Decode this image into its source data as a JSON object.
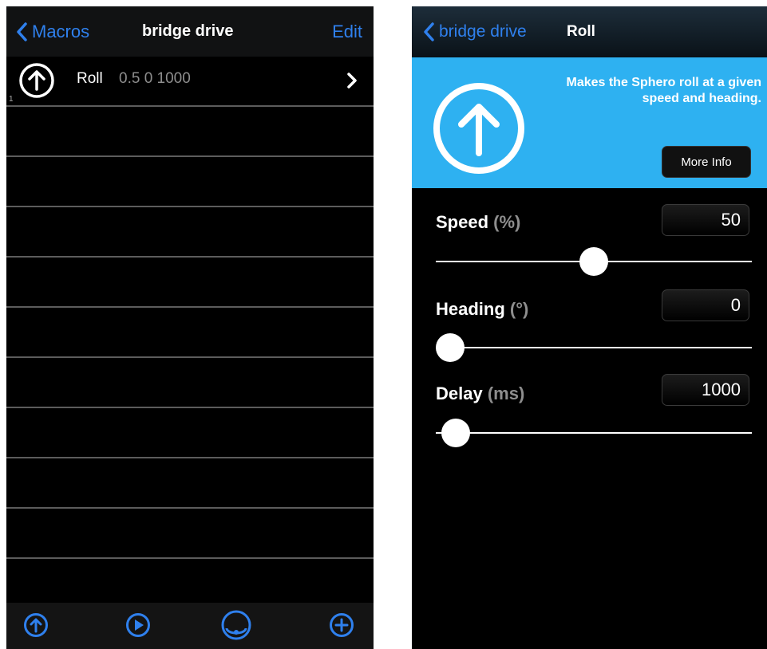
{
  "left": {
    "nav": {
      "back_label": "Macros",
      "title": "bridge drive",
      "edit_label": "Edit"
    },
    "rows": [
      {
        "index": "1",
        "icon": "arrow-up-circle-icon",
        "name": "Roll",
        "params": "0.5 0 1000"
      }
    ],
    "empty_row_count": 10,
    "toolbar": {
      "icons": [
        "arrow-up-circle-icon",
        "play-circle-icon",
        "orbit-circle-icon",
        "plus-circle-icon"
      ]
    },
    "colors": {
      "accent": "#2f80ed"
    }
  },
  "right": {
    "nav": {
      "back_label": "bridge drive",
      "title": "Roll"
    },
    "info": {
      "icon": "arrow-up-circle-icon",
      "description": "Makes the Sphero roll at a given speed and heading.",
      "more_label": "More Info"
    },
    "params": {
      "speed": {
        "label": "Speed",
        "unit": "(%)",
        "value": "50",
        "level": 0.5
      },
      "heading": {
        "label": "Heading",
        "unit": "(°)",
        "value": "0",
        "level": 0.0
      },
      "delay": {
        "label": "Delay",
        "unit": "(ms)",
        "value": "1000",
        "level": 0.02
      }
    },
    "colors": {
      "info_bg": "#2eb1f1"
    }
  }
}
